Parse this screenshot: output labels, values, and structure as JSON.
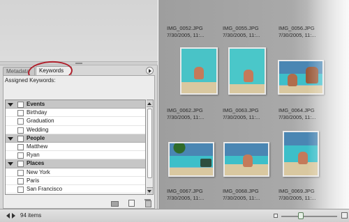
{
  "tabs": {
    "metadata": "Metadata",
    "keywords": "Keywords"
  },
  "keywords_panel": {
    "assigned_label": "Assigned Keywords:",
    "categories": [
      {
        "name": "Events",
        "items": [
          "Birthday",
          "Graduation",
          "Wedding"
        ]
      },
      {
        "name": "People",
        "items": [
          "Matthew",
          "Ryan"
        ]
      },
      {
        "name": "Places",
        "items": [
          "New York",
          "Paris",
          "San Francisco"
        ]
      }
    ]
  },
  "grid": {
    "files": [
      {
        "name": "IMG_0052.JPG",
        "date": "7/30/2005, 11:..."
      },
      {
        "name": "IMG_0055.JPG",
        "date": "7/30/2005, 11:..."
      },
      {
        "name": "IMG_0056.JPG",
        "date": "7/30/2005, 11:..."
      },
      {
        "name": "IMG_0062.JPG",
        "date": "7/30/2005, 11:..."
      },
      {
        "name": "IMG_0063.JPG",
        "date": "7/30/2005, 11:..."
      },
      {
        "name": "IMG_0064.JPG",
        "date": "7/30/2005, 11:..."
      },
      {
        "name": "IMG_0067.JPG",
        "date": "7/30/2005, 11:..."
      },
      {
        "name": "IMG_0068.JPG",
        "date": "7/30/2005, 11:..."
      },
      {
        "name": "IMG_0069.JPG",
        "date": "7/30/2005, 11:..."
      }
    ]
  },
  "statusbar": {
    "item_count": "94 items",
    "zoom_level": 0.35
  },
  "colors": {
    "highlight_ring": "#b0202c",
    "category_row": "#c6c6c6",
    "grid_background": "#a4a4a4"
  }
}
